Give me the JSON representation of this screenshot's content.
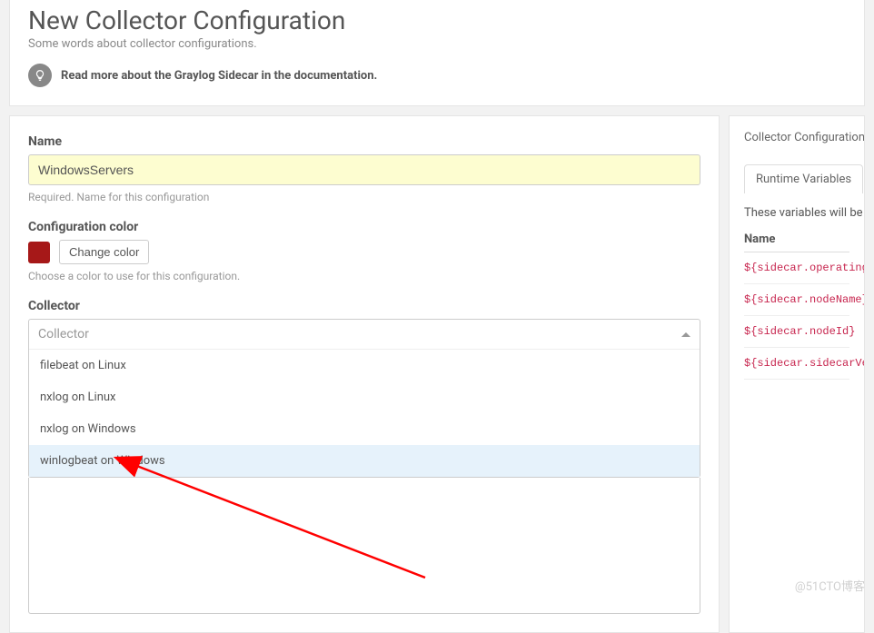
{
  "header": {
    "title": "New Collector Configuration",
    "subtitle": "Some words about collector configurations.",
    "info_text": "Read more about the Graylog Sidecar in the documentation."
  },
  "form": {
    "name_label": "Name",
    "name_value": "WindowsServers",
    "name_help": "Required. Name for this configuration",
    "color_label": "Configuration color",
    "color_swatch": "#a61818",
    "change_color_btn": "Change color",
    "color_help": "Choose a color to use for this configuration.",
    "collector_label": "Collector",
    "collector_placeholder": "Collector",
    "collector_options": [
      "filebeat on Linux",
      "nxlog on Linux",
      "nxlog on Windows",
      "winlogbeat on Windows"
    ]
  },
  "side": {
    "title": "Collector Configuration R",
    "tab_label": "Runtime Variables",
    "desc": "These variables will be fil",
    "th_name": "Name",
    "vars": [
      "${sidecar.operatingS",
      "${sidecar.nodeName}",
      "${sidecar.nodeId}",
      "${sidecar.sidecarVer"
    ]
  },
  "watermark": "@51CTO博客"
}
